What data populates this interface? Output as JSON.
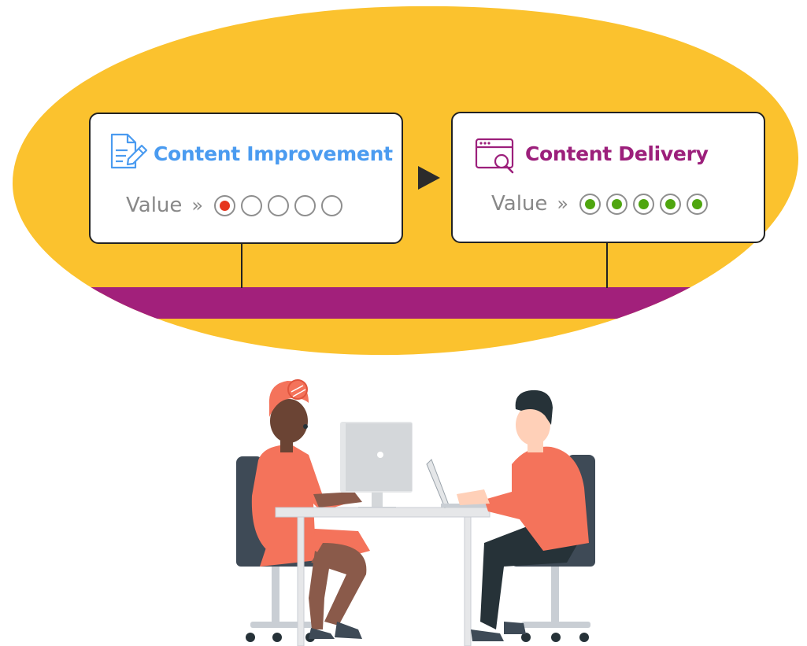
{
  "colors": {
    "ellipse": "#FBC22E",
    "band": "#A2207B",
    "improvement_title": "#4A9BF0",
    "delivery_title": "#9C1F7B",
    "dot_red": "#E6361E",
    "dot_green": "#4FA60F"
  },
  "flow": {
    "arrow_icon": "triangle-right",
    "cards": [
      {
        "title": "Content Improvement",
        "icon": "document-edit-icon",
        "value_label": "Value",
        "separator": "»",
        "rating": 1,
        "max_rating": 5,
        "rating_color": "dot_red"
      },
      {
        "title": "Content Delivery",
        "icon": "browser-search-icon",
        "value_label": "Value",
        "separator": "»",
        "rating": 5,
        "max_rating": 5,
        "rating_color": "dot_green"
      }
    ]
  },
  "illustration": {
    "scene": "two people working at a shared desk with a monitor and laptop"
  }
}
